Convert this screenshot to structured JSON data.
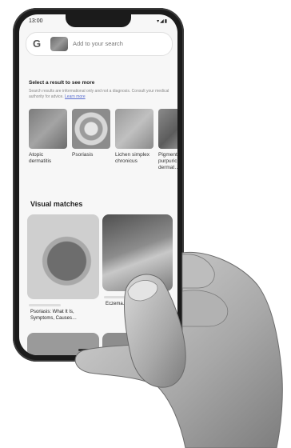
{
  "status": {
    "time": "13:00",
    "icons": "▾◢▮"
  },
  "search": {
    "logo": "G",
    "placeholder": "Add to your search"
  },
  "info": {
    "title": "Select a result to see more",
    "text": "Search results are informational only and not a diagnosis. Consult your medical authority for advice.",
    "learn_more": "Learn more"
  },
  "conditions": [
    {
      "label": "Atopic dermatitis"
    },
    {
      "label": "Psoriasis"
    },
    {
      "label": "Lichen simplex chronicus"
    },
    {
      "label": "Pigmented purpuric dermat…"
    }
  ],
  "visual_matches": {
    "title": "Visual matches",
    "cards": [
      {
        "caption": "Psoriasis: What It Is, Symptoms, Causes…"
      },
      {
        "caption": "Eczema… Dermati…"
      }
    ]
  }
}
